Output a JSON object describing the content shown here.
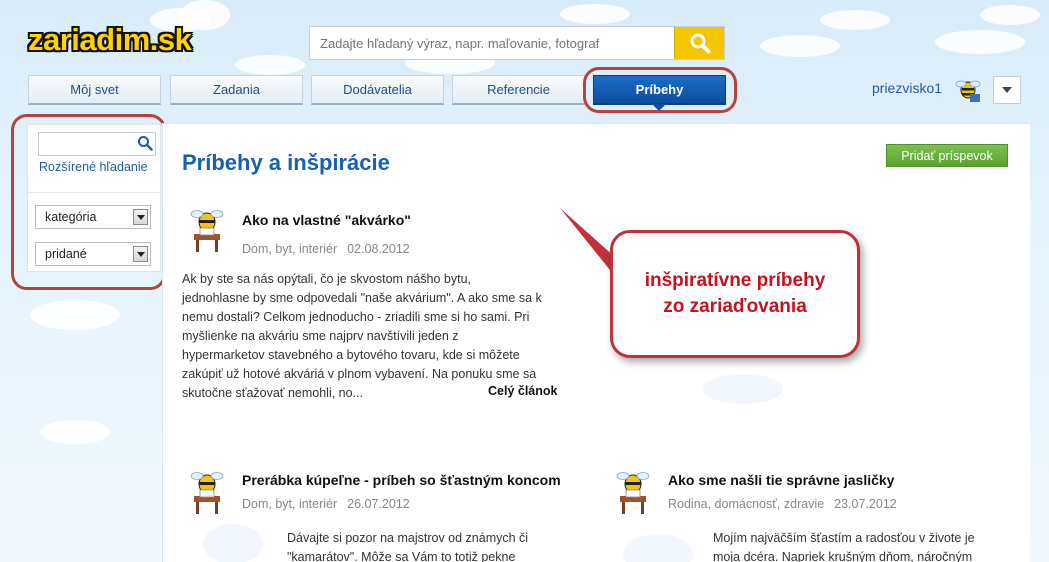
{
  "header": {
    "logo_text": "zariadim.sk",
    "search_placeholder": "Zadajte hľadaný výraz, napr. maľovanie, fotograf"
  },
  "tabs": [
    {
      "label": "Môj svet",
      "active": false
    },
    {
      "label": "Zadania",
      "active": false
    },
    {
      "label": "Dodávatelia",
      "active": false
    },
    {
      "label": "Referencie",
      "active": false
    },
    {
      "label": "Príbehy",
      "active": true
    }
  ],
  "user": {
    "name": "priezvisko1"
  },
  "sidebar": {
    "search_value": "",
    "advanced_search": "Rozšírené hľadanie",
    "category_select": "kategória",
    "added_select": "pridané"
  },
  "main": {
    "title": "Príbehy a inšpirácie",
    "add_button": "Pridať príspevok"
  },
  "articles": [
    {
      "title": "Ako na vlastné \"akvárko\"",
      "category": "Dom, byt, interiér",
      "date": "02.08.2012",
      "lines": [
        "Ak by ste sa nás opýtali, čo je skvostom nášho bytu,",
        "jednohlasne by sme odpovedali \"naše akvárium\". A ako sme sa k",
        "nemu dostali? Celkom jednoducho - zriadili sme si ho sami. Pri",
        "myšlienke na akváriu sme najprv navštívili jeden z",
        "hypermarketov stavebného a bytového tovaru, kde si môžete",
        "zakúpiť už hotové akváriá v plnom vybavení. Na ponuku sme sa",
        "skutočne sťažovať nemohli, no..."
      ],
      "read_more": "Celý článok"
    },
    {
      "title": "Prerábka kúpeľne - príbeh so šťastným koncom",
      "category": "Dom, byt, interiér",
      "date": "26.07.2012",
      "lines": [
        "Dávajte si pozor na majstrov od známych či",
        "\"kamarátov\". Môže sa Vám to totiž pekne"
      ]
    },
    {
      "title": "Ako sme našli tie správne jasličky",
      "category": "Rodina, domácnosť, zdravie",
      "date": "23.07.2012",
      "lines": [
        "Mojím najväčším šťastím a radosťou v živote je",
        "moja dcéra. Napriek krušným dňom, náročným"
      ]
    }
  ],
  "callout": {
    "line1": "inšpiratívne príbehy",
    "line2": "zo zariaďovania"
  },
  "colors": {
    "accent": "#1560b3",
    "highlight": "#b4443f",
    "callout_text": "#c8101e",
    "add_button": "#6bb23f",
    "search_button": "#f5c500"
  },
  "icons": {
    "search": "search-icon",
    "dropdown": "chevron-down-icon",
    "avatar": "bee-avatar-icon"
  }
}
